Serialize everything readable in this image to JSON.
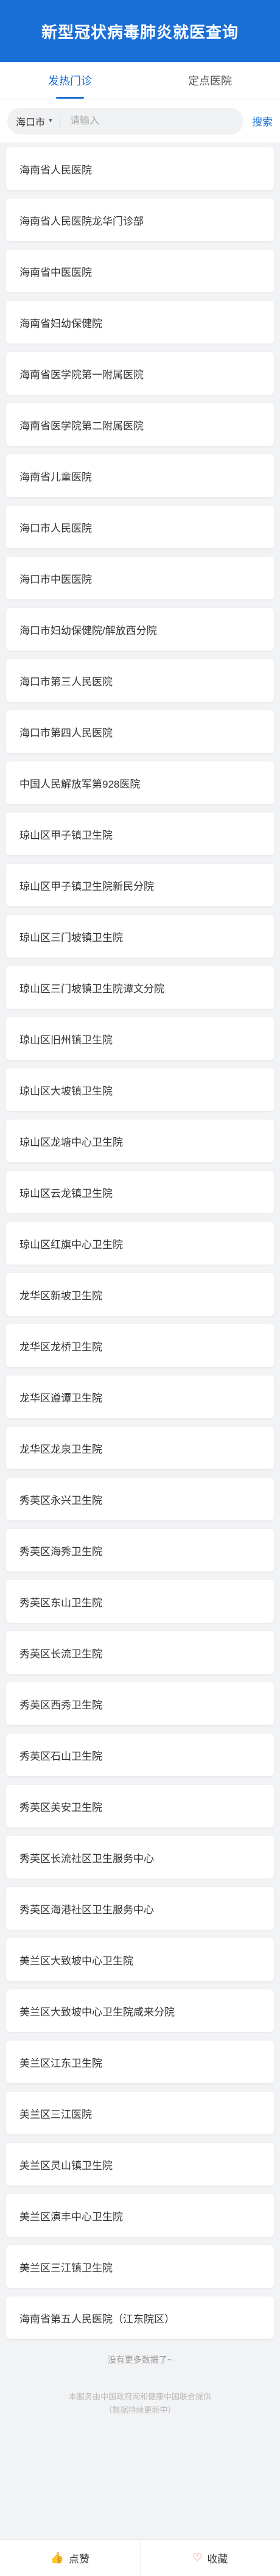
{
  "header": {
    "title": "新型冠状病毒肺炎就医查询"
  },
  "tabs": [
    {
      "label": "发热门诊",
      "active": true
    },
    {
      "label": "定点医院",
      "active": false
    }
  ],
  "search": {
    "city": "海口市",
    "placeholder": "请输入",
    "button_label": "搜索"
  },
  "hospitals": [
    "海南省人民医院",
    "海南省人民医院龙华门诊部",
    "海南省中医医院",
    "海南省妇幼保健院",
    "海南省医学院第一附属医院",
    "海南省医学院第二附属医院",
    "海南省儿童医院",
    "海口市人民医院",
    "海口市中医医院",
    "海口市妇幼保健院/解放西分院",
    "海口市第三人民医院",
    "海口市第四人民医院",
    "中国人民解放军第928医院",
    "琼山区甲子镇卫生院",
    "琼山区甲子镇卫生院新民分院",
    "琼山区三门坡镇卫生院",
    "琼山区三门坡镇卫生院谭文分院",
    "琼山区旧州镇卫生院",
    "琼山区大坡镇卫生院",
    "琼山区龙塘中心卫生院",
    "琼山区云龙镇卫生院",
    "琼山区红旗中心卫生院",
    "龙华区新坡卫生院",
    "龙华区龙桥卫生院",
    "龙华区遵谭卫生院",
    "龙华区龙泉卫生院",
    "秀英区永兴卫生院",
    "秀英区海秀卫生院",
    "秀英区东山卫生院",
    "秀英区长流卫生院",
    "秀英区西秀卫生院",
    "秀英区石山卫生院",
    "秀英区美安卫生院",
    "秀英区长流社区卫生服务中心",
    "秀英区海港社区卫生服务中心",
    "美兰区大致坡中心卫生院",
    "美兰区大致坡中心卫生院咸来分院",
    "美兰区江东卫生院",
    "美兰区三江医院",
    "美兰区灵山镇卫生院",
    "美兰区演丰中心卫生院",
    "美兰区三江镇卫生院",
    "海南省第五人民医院（江东院区）"
  ],
  "footer": {
    "no_more": "没有更多数据了~",
    "disclaimer_line1": "本服务由中国政府网和健康中国联合提供",
    "disclaimer_line2": "（数据持续更新中）"
  },
  "bottom_bar": {
    "like_label": "点赞",
    "favorite_label": "收藏"
  },
  "colors": {
    "brand": "#1a6fd6",
    "background": "#f2f3f5"
  }
}
